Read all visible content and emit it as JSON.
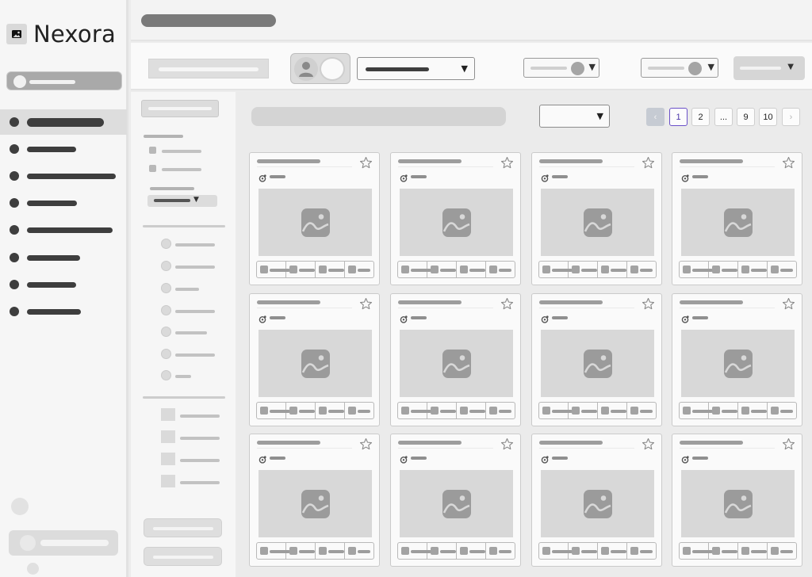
{
  "app": {
    "name": "Nexora"
  },
  "sidebar": {
    "nav_count": 8,
    "active_index": 0
  },
  "pagination": {
    "prev_glyph": "‹",
    "pages": [
      "1",
      "2",
      "...",
      "9",
      "10"
    ],
    "current": "1",
    "next_glyph": "›"
  },
  "grid": {
    "rows": 3,
    "cols": 4
  },
  "icons": {
    "logo": "image-icon",
    "card_favorite": "star-icon",
    "card_image": "image-placeholder-icon",
    "card_badge": "refresh-icon",
    "toolbar_avatar": "user-icon",
    "dropdown": "caret-down-icon"
  },
  "colors": {
    "accent_pagination": "#6a50c8",
    "sidebar_active": "#dddddd",
    "placeholder_dark": "#3e3e3e"
  },
  "dropdown_caret": "▼"
}
